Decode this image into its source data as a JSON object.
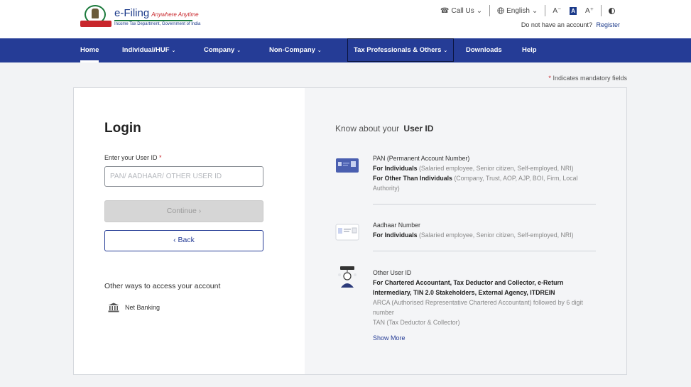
{
  "header": {
    "logo_title": "e-Filing",
    "logo_tagline": "Anywhere Anytime",
    "logo_subtitle": "Income Tax Department, Government of India",
    "call_us": "Call Us",
    "language": "English",
    "font_decrease": "A⁻",
    "font_normal": "A",
    "font_increase": "A⁺",
    "no_account_text": "Do not have an account?",
    "register_link": "Register"
  },
  "nav": {
    "items": [
      {
        "label": "Home",
        "active": true
      },
      {
        "label": "Individual/HUF",
        "dropdown": true
      },
      {
        "label": "Company",
        "dropdown": true
      },
      {
        "label": "Non-Company",
        "dropdown": true
      },
      {
        "label": "Tax Professionals & Others",
        "dropdown": true
      },
      {
        "label": "Downloads"
      },
      {
        "label": "Help"
      }
    ]
  },
  "mandatory_note": "Indicates mandatory fields",
  "login": {
    "title": "Login",
    "user_id_label": "Enter your User ID",
    "user_id_value": "",
    "user_id_placeholder": "PAN/ AADHAAR/ OTHER USER ID",
    "continue_label": "Continue",
    "back_label": "Back",
    "other_ways": "Other ways to access your account",
    "net_banking": "Net Banking"
  },
  "know_about": {
    "prefix": "Know about your",
    "highlight": "User ID",
    "pan": {
      "title": "PAN (Permanent Account Number)",
      "ind_bold": "For Individuals",
      "ind_rest": " (Salaried employee, Senior citizen, Self-employed, NRI)",
      "other_bold": "For Other Than Individuals",
      "other_rest": " (Company, Trust, AOP, AJP, BOI, Firm, Local Authority)"
    },
    "aadhaar": {
      "title": "Aadhaar Number",
      "ind_bold": "For Individuals",
      "ind_rest": " (Salaried employee, Senior citizen, Self-employed, NRI)"
    },
    "other": {
      "title": "Other User ID",
      "bold": "For Chartered Accountant, Tax Deductor and Collector, e-Return Intermediary, TIN 2.0 Stakeholders, External Agency, ITDREIN",
      "line1": "ARCA (Authorised Representative Chartered Accountant) followed by 6 digit number",
      "line2": "TAN (Tax Deductor & Collector)"
    },
    "show_more": "Show More"
  },
  "colors": {
    "nav_bg": "#253c96",
    "brand_blue": "#1b3a8a",
    "required_red": "#c8262b"
  }
}
